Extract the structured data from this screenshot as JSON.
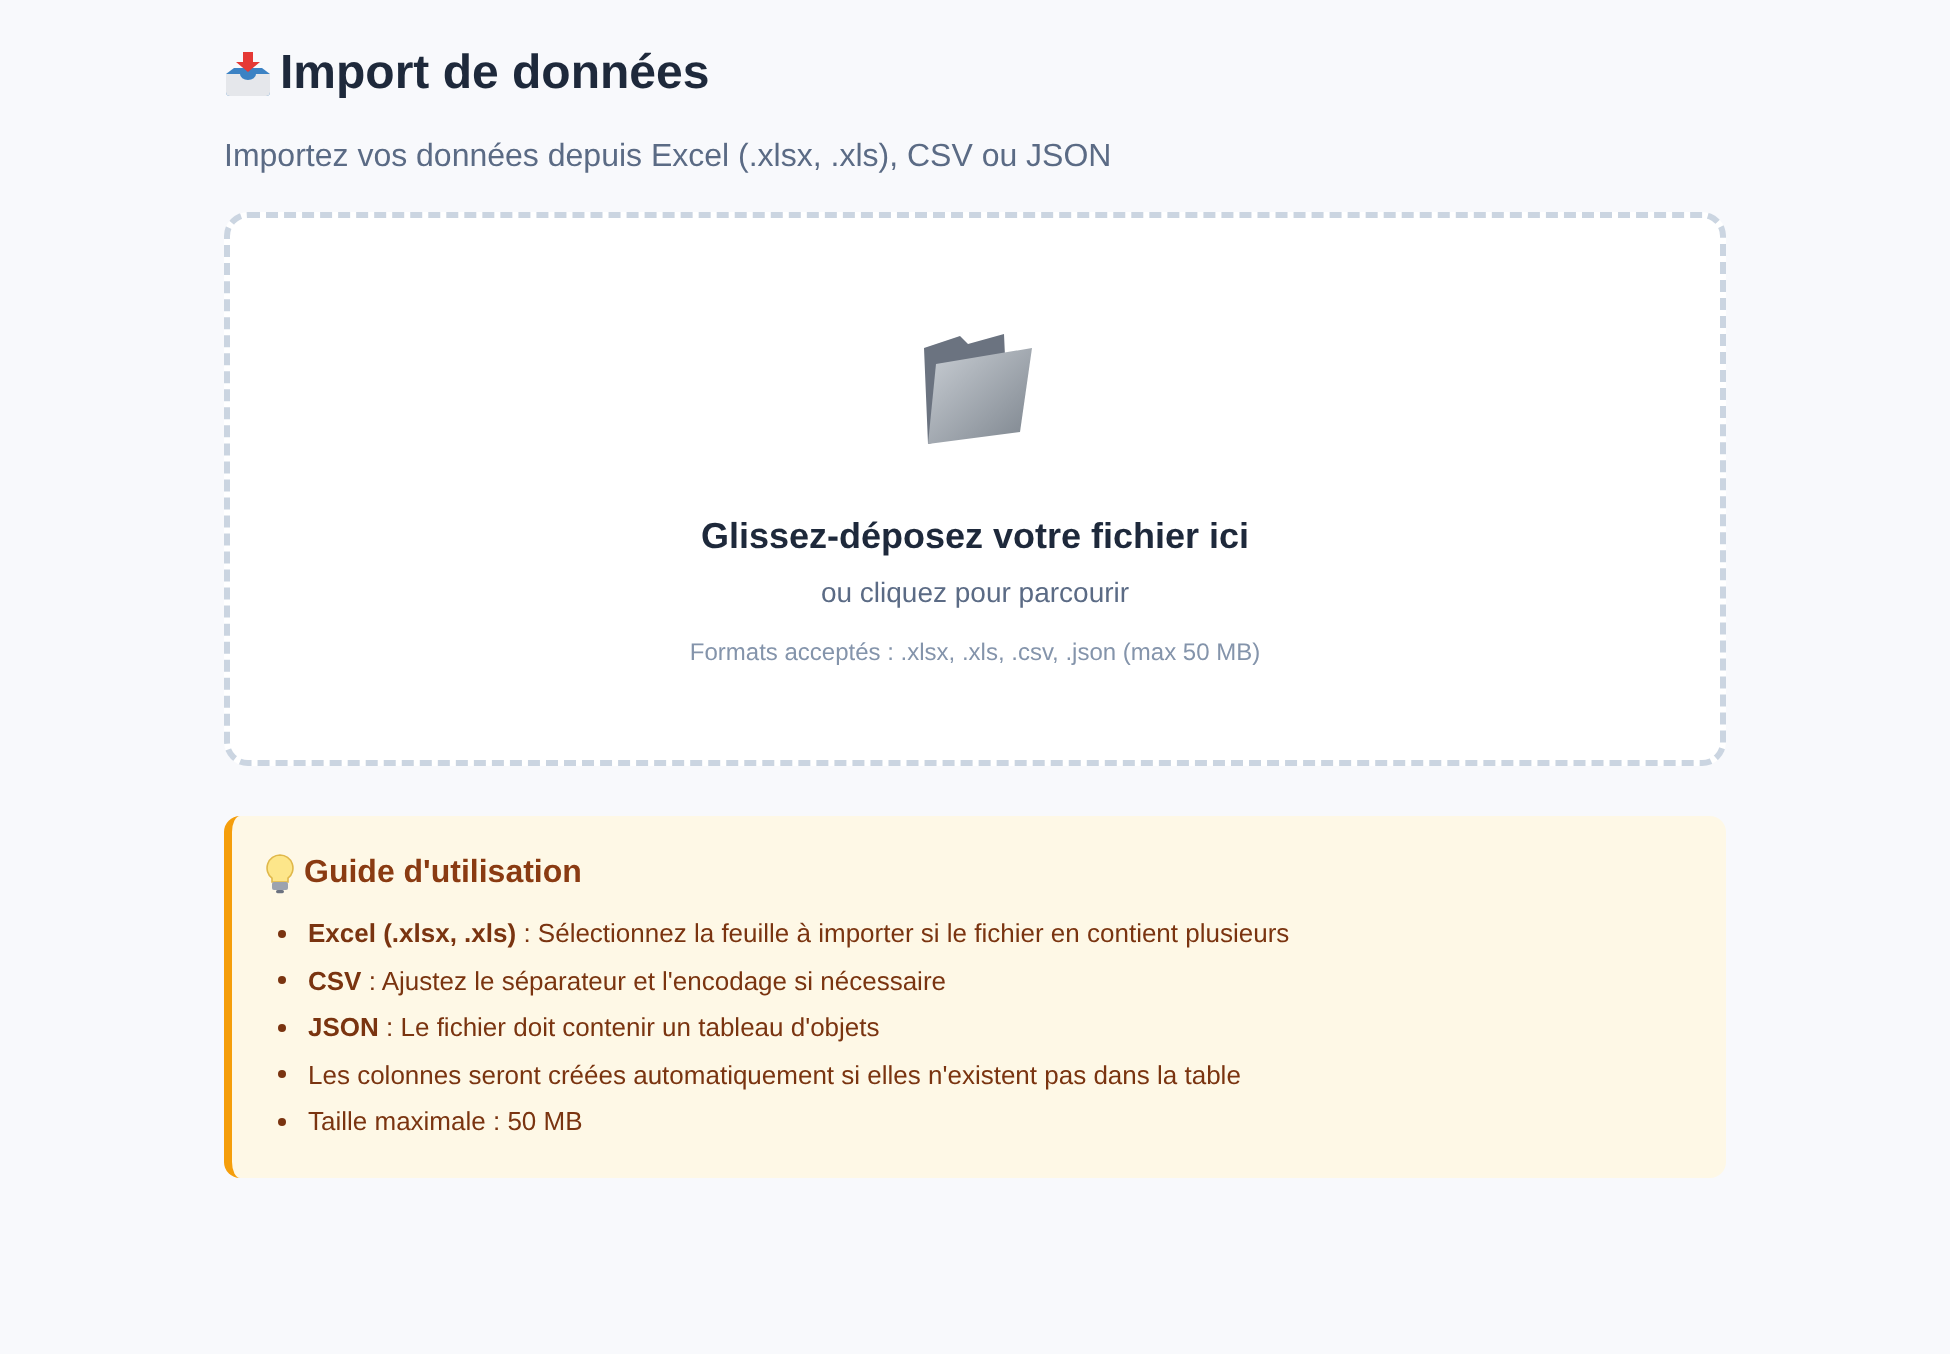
{
  "header": {
    "title": "Import de données",
    "subtitle": "Importez vos données depuis Excel (.xlsx, .xls), CSV ou JSON"
  },
  "dropzone": {
    "title": "Glissez-déposez votre fichier ici",
    "subtitle": "ou cliquez pour parcourir",
    "formats": "Formats acceptés : .xlsx, .xls, .csv, .json (max 50 MB)"
  },
  "guide": {
    "title": "Guide d'utilisation",
    "items": [
      "**Excel (.xlsx, .xls)** : Sélectionnez la feuille à importer si le fichier en contient plusieurs",
      "**CSV** : Ajustez le séparateur et l'encodage si nécessaire",
      "**JSON** : Le fichier doit contenir un tableau d'objets",
      "Les colonnes seront créées automatiquement si elles n'existent pas dans la table",
      "Taille maximale : 50 MB"
    ]
  }
}
